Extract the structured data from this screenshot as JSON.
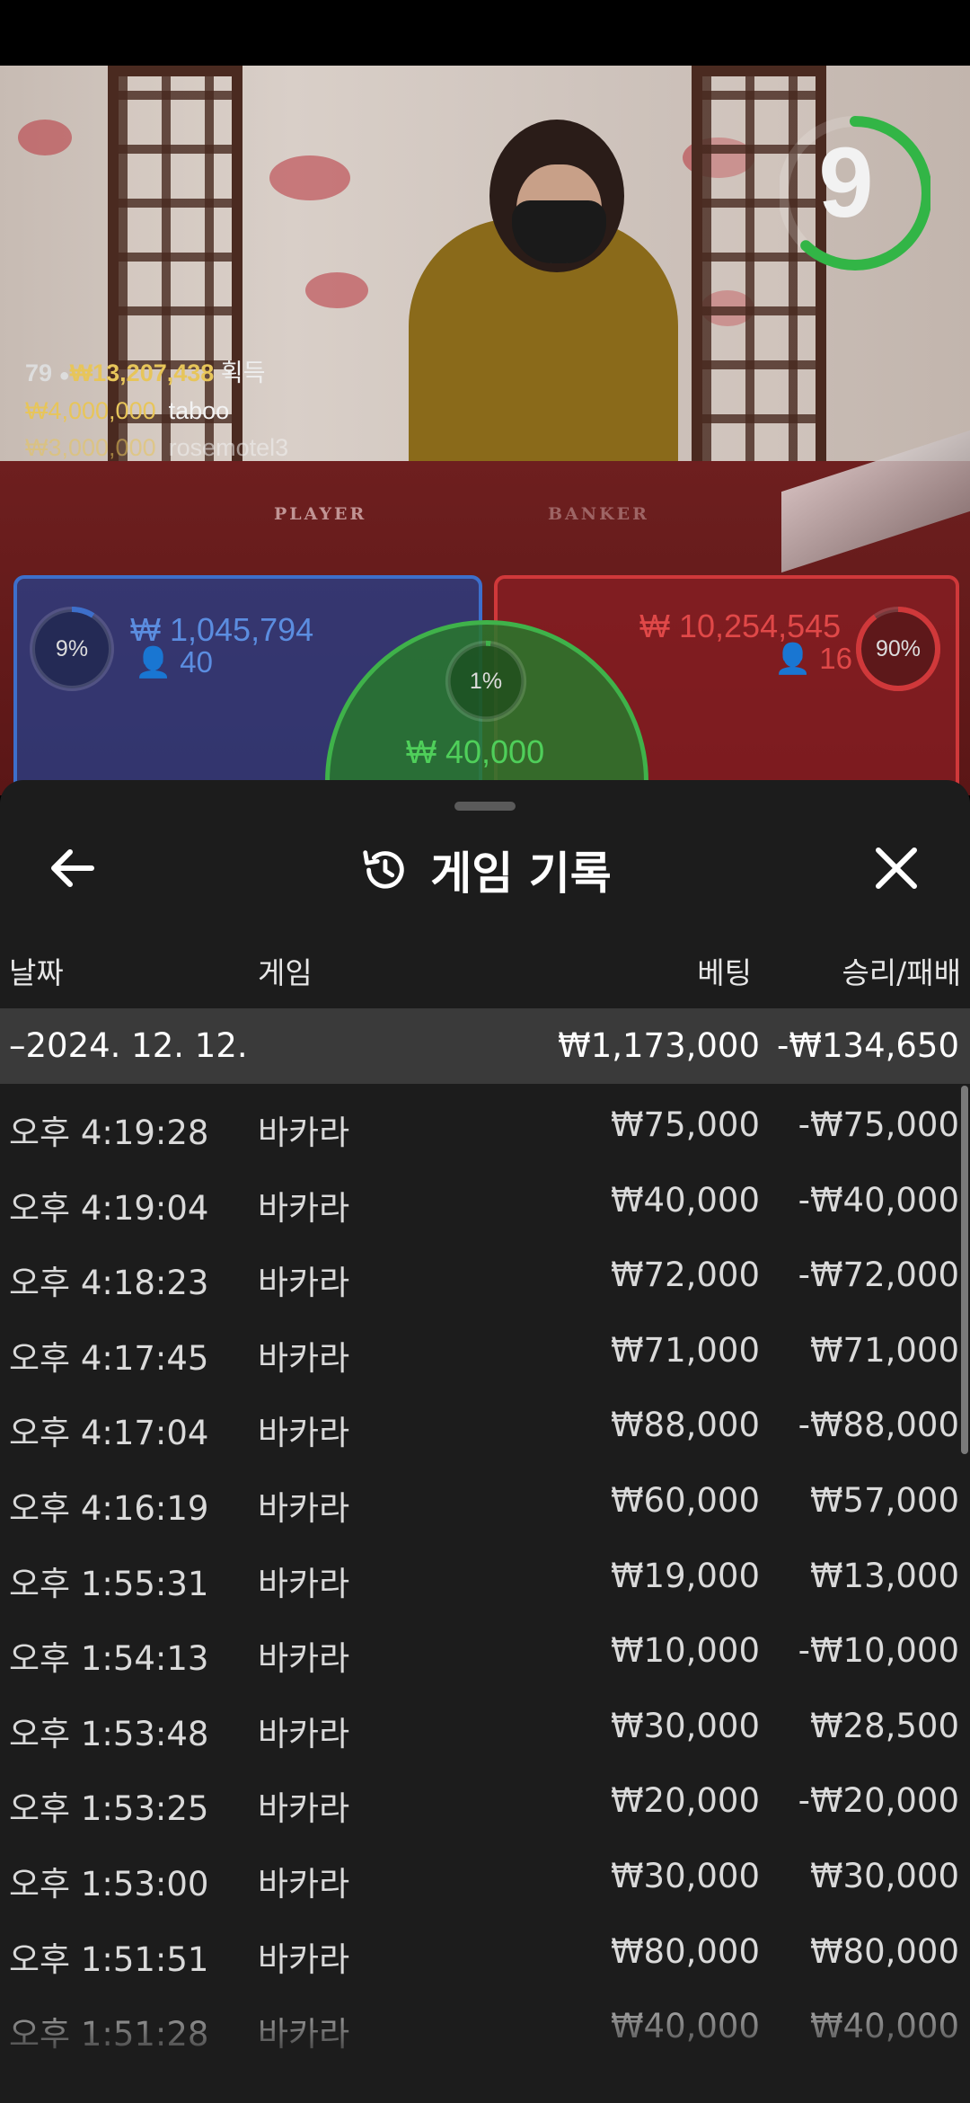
{
  "timer": {
    "value": "9",
    "progress": 0.62,
    "color": "#32b546"
  },
  "winners": {
    "count": "79",
    "total": "₩13,207,438",
    "total_label": "획득",
    "list": [
      {
        "amount": "₩4,000,000",
        "name": "taboo"
      },
      {
        "amount": "₩3,000,000",
        "name": "rosemotel3"
      }
    ]
  },
  "table_labels": {
    "player": "PLAYER",
    "banker": "BANKER"
  },
  "bets": {
    "player": {
      "pct": "9%",
      "amount": "₩ 1,045,794",
      "players": "40",
      "color": "#3d6fcb",
      "fill": 0.09
    },
    "banker": {
      "pct": "90%",
      "amount": "₩ 10,254,545",
      "players": "16",
      "color": "#d0383a",
      "fill": 0.9
    },
    "tie": {
      "pct": "1%",
      "amount": "₩ 40,000",
      "color": "#3fb24a",
      "fill": 0.01
    }
  },
  "history": {
    "title": "게임 기록",
    "icons": {
      "back": "arrow-left-icon",
      "close": "close-icon",
      "title": "history-icon"
    },
    "columns": {
      "date": "날짜",
      "game": "게임",
      "bet": "베팅",
      "result": "승리/패배"
    },
    "day": {
      "date": "–2024. 12. 12.",
      "bet": "₩1,173,000",
      "result": "-₩134,650"
    },
    "rows": [
      {
        "time": "오후 4:19:28",
        "game": "바카라",
        "bet": "₩75,000",
        "result": "-₩75,000"
      },
      {
        "time": "오후 4:19:04",
        "game": "바카라",
        "bet": "₩40,000",
        "result": "-₩40,000"
      },
      {
        "time": "오후 4:18:23",
        "game": "바카라",
        "bet": "₩72,000",
        "result": "-₩72,000"
      },
      {
        "time": "오후 4:17:45",
        "game": "바카라",
        "bet": "₩71,000",
        "result": "₩71,000"
      },
      {
        "time": "오후 4:17:04",
        "game": "바카라",
        "bet": "₩88,000",
        "result": "-₩88,000"
      },
      {
        "time": "오후 4:16:19",
        "game": "바카라",
        "bet": "₩60,000",
        "result": "₩57,000"
      },
      {
        "time": "오후 1:55:31",
        "game": "바카라",
        "bet": "₩19,000",
        "result": "₩13,000"
      },
      {
        "time": "오후 1:54:13",
        "game": "바카라",
        "bet": "₩10,000",
        "result": "-₩10,000"
      },
      {
        "time": "오후 1:53:48",
        "game": "바카라",
        "bet": "₩30,000",
        "result": "₩28,500"
      },
      {
        "time": "오후 1:53:25",
        "game": "바카라",
        "bet": "₩20,000",
        "result": "-₩20,000"
      },
      {
        "time": "오후 1:53:00",
        "game": "바카라",
        "bet": "₩30,000",
        "result": "₩30,000"
      },
      {
        "time": "오후 1:51:51",
        "game": "바카라",
        "bet": "₩80,000",
        "result": "₩80,000"
      },
      {
        "time": "오후 1:51:28",
        "game": "바카라",
        "bet": "₩40,000",
        "result": "₩40,000"
      }
    ]
  }
}
